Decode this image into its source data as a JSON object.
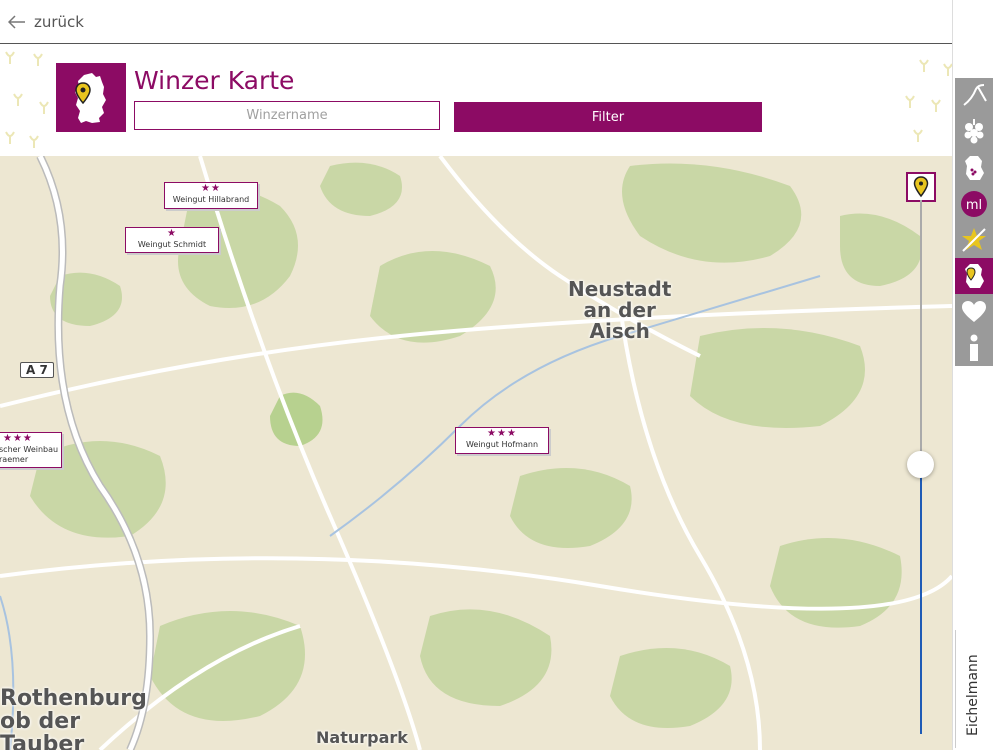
{
  "topbar": {
    "back_label": "zurück"
  },
  "header": {
    "title": "Winzer Karte",
    "search_placeholder": "Winzername",
    "filter_label": "Filter"
  },
  "map": {
    "cities": [
      {
        "label": "Neustadt\nan der\nAisch"
      },
      {
        "label": "Rothenburg\nob der\nTauber"
      },
      {
        "label": "Naturpark"
      }
    ],
    "road": "A 7",
    "wineries": [
      {
        "stars": "★★",
        "name": "Weingut Hillabrand"
      },
      {
        "stars": "★",
        "name": "Weingut Schmidt"
      },
      {
        "stars": "★★★",
        "name": "Weingut Hofmann"
      },
      {
        "stars": "★★★",
        "name": "scher Weinbau\nraemer"
      }
    ]
  },
  "sidebar": {
    "items": [
      {
        "icon": "wine-glass-icon"
      },
      {
        "icon": "grapes-icon"
      },
      {
        "icon": "region-icon"
      },
      {
        "icon": "ml-logo-icon"
      },
      {
        "icon": "star-award-icon"
      },
      {
        "icon": "germany-map-icon",
        "active": true
      },
      {
        "icon": "heart-icon"
      },
      {
        "icon": "info-icon"
      }
    ],
    "author": "Eichelmann"
  },
  "colors": {
    "brand": "#8c0b64",
    "map_bg": "#ede7d2",
    "forest": "#c9d7a6",
    "zoom_active": "#1f5bb6"
  }
}
